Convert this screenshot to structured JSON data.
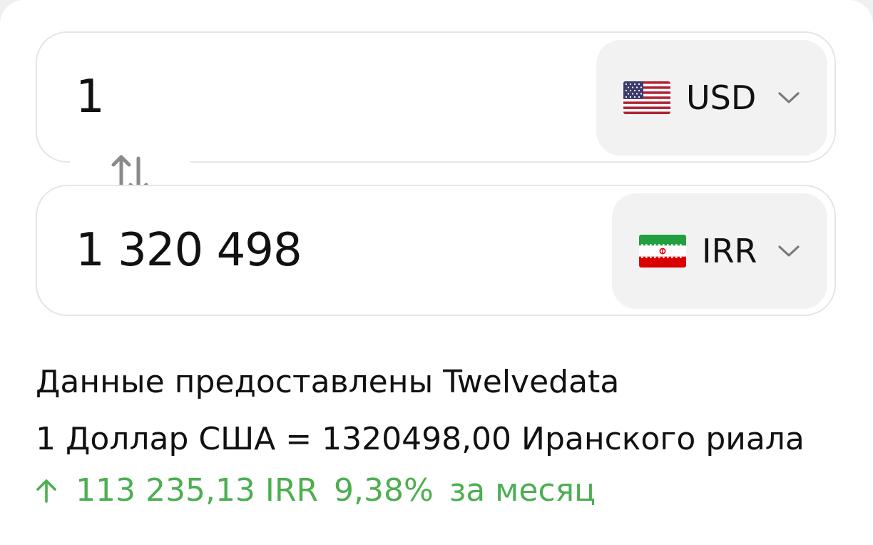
{
  "converter": {
    "from": {
      "amount": "1",
      "currency_code": "USD",
      "flag_icon": "us-flag-icon"
    },
    "to": {
      "amount": "1 320 498",
      "currency_code": "IRR",
      "flag_icon": "iran-flag-icon"
    },
    "swap_icon": "swap-arrows-icon"
  },
  "info": {
    "source_text": "Данные предоставлены Twelvedata",
    "rate_text": "1 Доллар США = 1320498,00 Иранского риала",
    "change": {
      "direction_icon": "arrow-up-icon",
      "amount": "113 235,13 IRR",
      "percent": "9,38%",
      "period": "за месяц",
      "color": "#4caf50"
    }
  },
  "colors": {
    "pill_background": "#f2f2f2",
    "border": "#e5e5e5",
    "text": "#111111"
  }
}
